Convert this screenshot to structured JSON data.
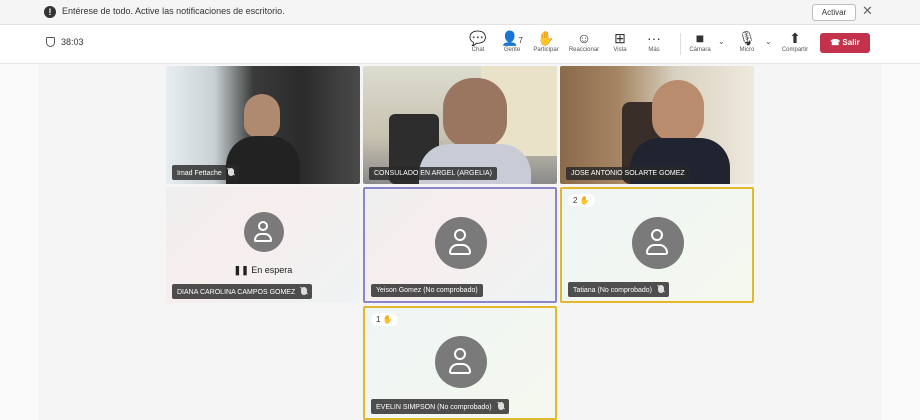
{
  "notification": {
    "info_icon": "info-icon",
    "info_glyph": "!",
    "message": "Entérese de todo. Active las notificaciones de escritorio.",
    "activate_label": "Activar",
    "close_glyph": "✕"
  },
  "meeting": {
    "timer": "38:03"
  },
  "toolbar": {
    "chat": {
      "label": "Chat",
      "glyph": "💬"
    },
    "people": {
      "label": "Gente",
      "glyph": "👤",
      "count": "7"
    },
    "participate": {
      "label": "Participar",
      "glyph": "✋"
    },
    "react": {
      "label": "Reaccionar",
      "glyph": "☺"
    },
    "view": {
      "label": "Vista",
      "glyph": "⊞"
    },
    "more": {
      "label": "Más",
      "glyph": "···"
    },
    "camera": {
      "label": "Cámara",
      "glyph": "■"
    },
    "mic": {
      "label": "Micro",
      "glyph": "🎙"
    },
    "share": {
      "label": "Compartir",
      "glyph": "⬆"
    },
    "chevron_glyph": "⌄",
    "leave": {
      "label": "Salir",
      "glyph": "☎"
    },
    "leave_color": "#c4314b"
  },
  "participants": [
    {
      "name": "Imad Fettache",
      "type": "video",
      "muted": true
    },
    {
      "name": "CONSULADO EN ARGEL (ARGELIA)",
      "type": "video",
      "muted": false
    },
    {
      "name": "JOSE ANTONIO SOLARTE GOMEZ",
      "type": "video",
      "muted": false
    },
    {
      "name": "DIANA CAROLINA CAMPOS GOMEZ",
      "type": "avatar",
      "muted": true,
      "status": "En espera"
    },
    {
      "name": "Yeison Gomez (No comprobado)",
      "type": "avatar",
      "muted": false,
      "highlight": "#8a86c9"
    },
    {
      "name": "Tatiana (No comprobado)",
      "type": "avatar",
      "muted": true,
      "hand_raise_order": "2",
      "highlight": "#e4b82e"
    },
    {
      "name": "EVELIN SIMPSON (No comprobado)",
      "type": "avatar",
      "muted": true,
      "hand_raise_order": "1",
      "highlight": "#e4b82e"
    }
  ],
  "glyphs": {
    "hand": "✋",
    "pause": "❚❚"
  }
}
